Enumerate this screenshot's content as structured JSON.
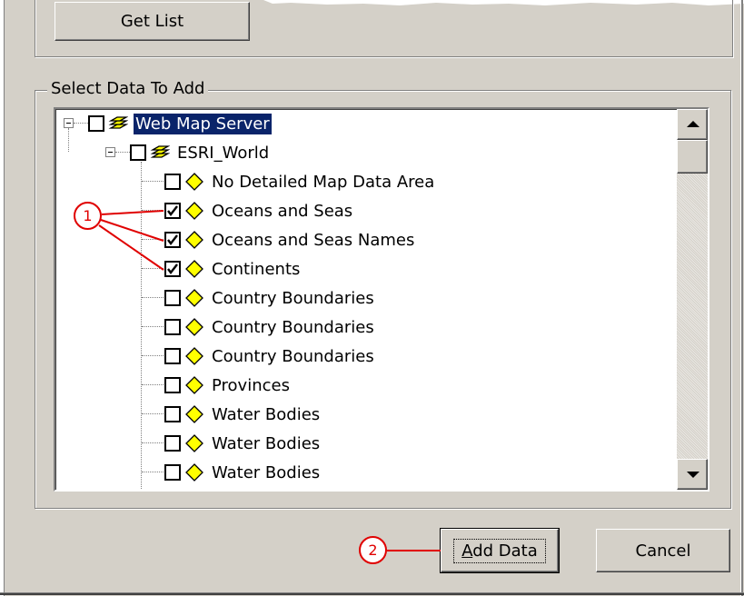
{
  "buttons": {
    "get_list": "Get List",
    "add_data": "Add Data",
    "add_data_mnemonic": "A",
    "add_data_rest": "dd Data",
    "cancel": "Cancel"
  },
  "group": {
    "label": "Select Data To Add"
  },
  "tree": {
    "root": {
      "label": "Web Map Server",
      "checked": false,
      "selected": true,
      "icon": "layer-stack-icon"
    },
    "service": {
      "label": "ESRI_World",
      "checked": false,
      "icon": "layer-stack-icon"
    },
    "layers": [
      {
        "label": "No Detailed Map Data Area",
        "checked": false
      },
      {
        "label": "Oceans and Seas",
        "checked": true
      },
      {
        "label": "Oceans and Seas Names",
        "checked": true
      },
      {
        "label": "Continents",
        "checked": true
      },
      {
        "label": "Country Boundaries",
        "checked": false
      },
      {
        "label": "Country Boundaries",
        "checked": false
      },
      {
        "label": "Country Boundaries",
        "checked": false
      },
      {
        "label": "Provinces",
        "checked": false
      },
      {
        "label": "Water Bodies",
        "checked": false
      },
      {
        "label": "Water Bodies",
        "checked": false
      },
      {
        "label": "Water Bodies",
        "checked": false
      }
    ]
  },
  "callouts": {
    "one": "1",
    "two": "2"
  },
  "colors": {
    "selection": "#0a246a",
    "callout": "#e00000",
    "layer_icon": "#ffff00"
  }
}
